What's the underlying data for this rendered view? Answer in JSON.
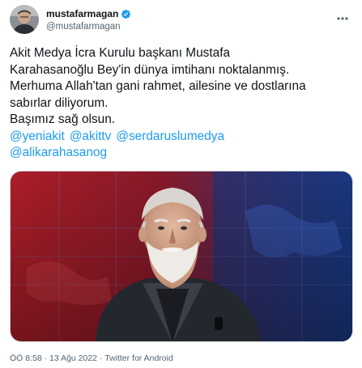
{
  "user": {
    "display_name": "mustafarmagan",
    "handle": "@mustafarmagan",
    "verified": true
  },
  "tweet": {
    "lines": [
      "Akit Medya İcra Kurulu başkanı Mustafa",
      "Karahasanoğlu Bey'in dünya imtihanı noktalanmış.",
      "Merhuma Allah'tan gani rahmet, ailesine ve dostlarına",
      "sabırlar diliyorum.",
      "Başımız sağ olsun."
    ],
    "mentions_line1": [
      "@yeniakit",
      "@akittv",
      "@serdaruslumedya"
    ],
    "mentions_line2": [
      "@alikarahasanog"
    ]
  },
  "meta": {
    "time": "ÖÖ 8:58",
    "date": "13 Ağu 2022",
    "source": "Twitter for Android",
    "separator": "·"
  },
  "colors": {
    "link": "#1d9bf0",
    "text": "#0f1419",
    "secondary": "#536471",
    "verified": "#1d9bf0"
  },
  "icons": {
    "verified": "verified-badge-icon",
    "more": "more-horizontal-icon"
  }
}
